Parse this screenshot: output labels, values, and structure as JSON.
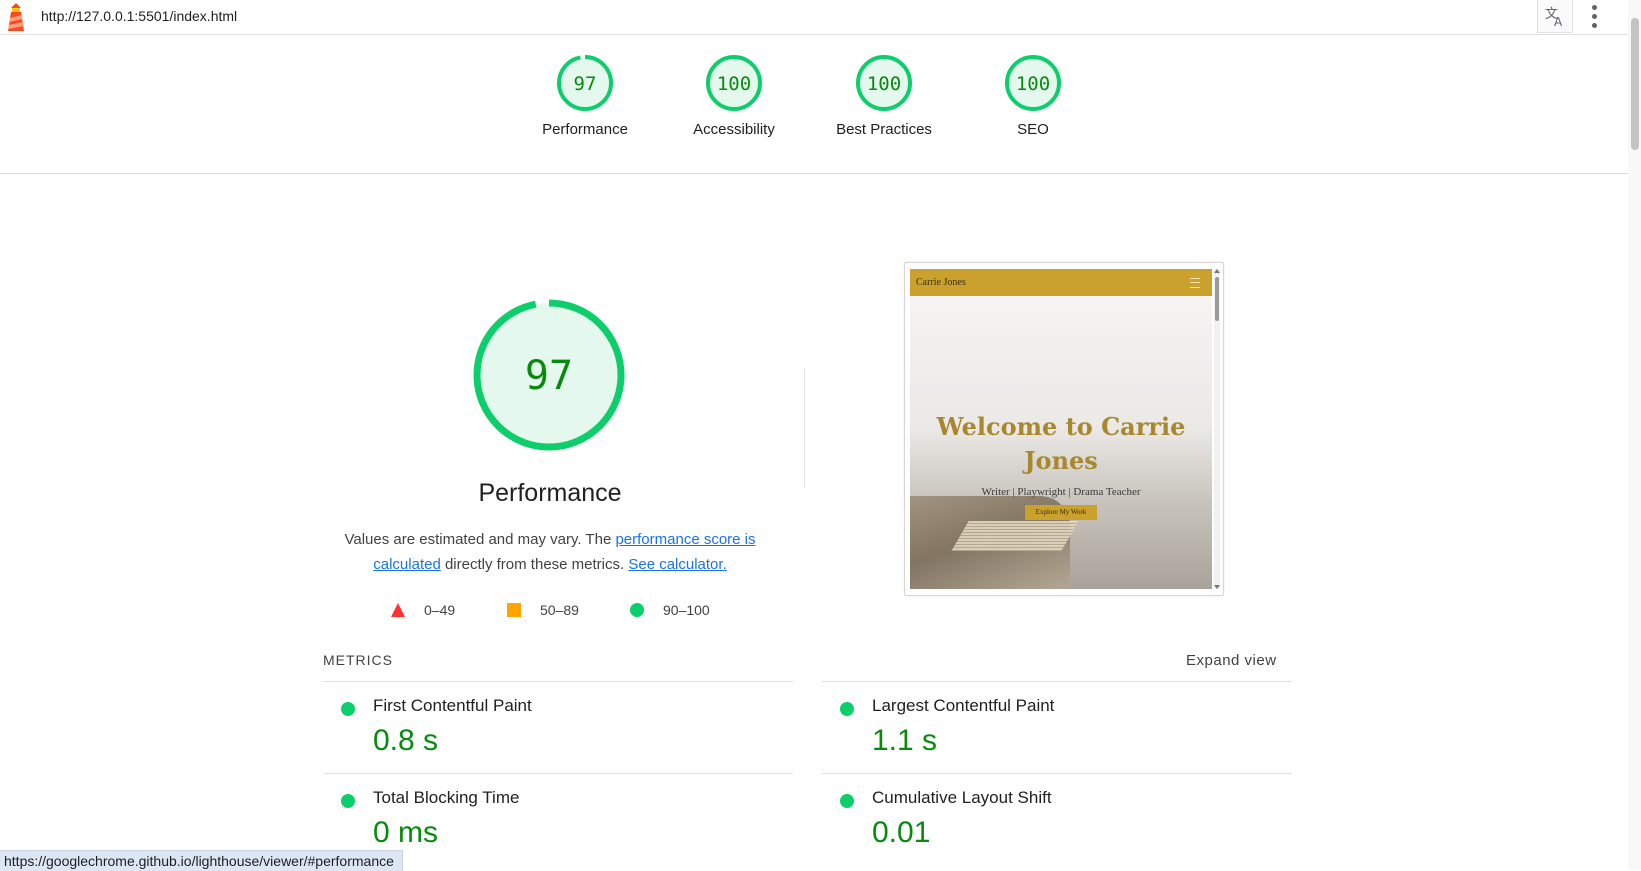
{
  "browser": {
    "url": "http://127.0.0.1:5501/index.html",
    "logo_icon": "lighthouse-icon",
    "translate_icon": "translate-icon",
    "menu_icon": "kebab-menu-icon",
    "status_url": "https://googlechrome.github.io/lighthouse/viewer/#performance"
  },
  "scores": [
    {
      "label": "Performance",
      "score": "97",
      "value": 97
    },
    {
      "label": "Accessibility",
      "score": "100",
      "value": 100
    },
    {
      "label": "Best Practices",
      "score": "100",
      "value": 100
    },
    {
      "label": "SEO",
      "score": "100",
      "value": 100
    }
  ],
  "performance": {
    "score": "97",
    "value": 97,
    "title": "Performance",
    "desc_prefix": "Values are estimated and may vary. The ",
    "desc_link1": "performance score is calculated",
    "desc_middle": " directly from these metrics. ",
    "desc_link2": "See calculator.",
    "legend": [
      {
        "range": "0–49",
        "shape": "triangle",
        "color": "#ff3333"
      },
      {
        "range": "50–89",
        "shape": "square",
        "color": "#ffa400"
      },
      {
        "range": "90–100",
        "shape": "circle",
        "color": "#0cce6b"
      }
    ]
  },
  "thumbnail": {
    "brand": "Carrie Jones",
    "headline": "Welcome to Carrie Jones",
    "subtitle": "Writer | Playwright | Drama Teacher",
    "button": "Explore My Work"
  },
  "metrics": {
    "heading": "METRICS",
    "expand_label": "Expand view",
    "items": [
      {
        "title": "First Contentful Paint",
        "value": "0.8 s"
      },
      {
        "title": "Largest Contentful Paint",
        "value": "1.1 s"
      },
      {
        "title": "Total Blocking Time",
        "value": "0 ms"
      },
      {
        "title": "Cumulative Layout Shift",
        "value": "0.01"
      }
    ]
  },
  "colors": {
    "pass": "#0cce6b",
    "pass_text": "#088a0f",
    "pass_fill": "#e5f8ee",
    "link": "#1a73e8",
    "thumb_accent": "#c9a12c"
  }
}
